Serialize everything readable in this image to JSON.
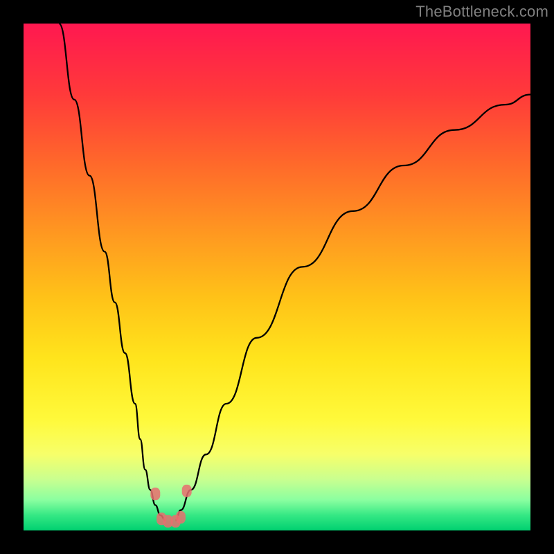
{
  "watermark": "TheBottleneck.com",
  "chart_data": {
    "type": "line",
    "title": "",
    "xlabel": "",
    "ylabel": "",
    "xlim": [
      0,
      100
    ],
    "ylim": [
      0,
      100
    ],
    "grid": false,
    "legend": false,
    "background": "red-yellow-green vertical gradient",
    "series": [
      {
        "name": "left-branch",
        "x": [
          7,
          10,
          13,
          16,
          18,
          20,
          22,
          23,
          24,
          25,
          26,
          27,
          28
        ],
        "y": [
          100,
          85,
          70,
          55,
          45,
          35,
          25,
          18,
          12,
          8,
          5,
          3,
          2
        ]
      },
      {
        "name": "right-branch",
        "x": [
          30,
          31,
          33,
          36,
          40,
          46,
          55,
          65,
          75,
          85,
          95,
          100
        ],
        "y": [
          2,
          4,
          8,
          15,
          25,
          38,
          52,
          63,
          72,
          79,
          84,
          86
        ]
      }
    ],
    "markers": {
      "name": "bottom-cluster",
      "x": [
        26,
        27.2,
        28.5,
        30,
        31,
        32.2
      ],
      "y": [
        7.2,
        2.3,
        1.8,
        1.8,
        2.6,
        7.8
      ]
    },
    "note": "Values estimated from pixel positions; no axis tick labels present."
  }
}
